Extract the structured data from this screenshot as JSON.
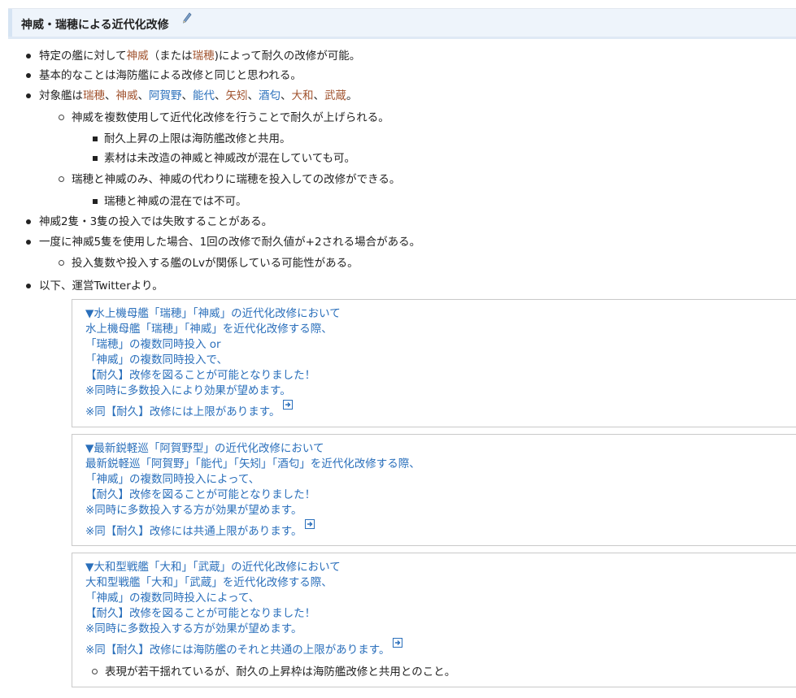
{
  "heading": {
    "title": "神威・瑞穂による近代化改修"
  },
  "bullets": {
    "b1": {
      "pre": "特定の艦に対して",
      "link1": "神威",
      "mid1": "（または",
      "link2": "瑞穂",
      "post": ")によって耐久の改修が可能。"
    },
    "b2": {
      "text": "基本的なことは海防艦による改修と同じと思われる。"
    },
    "b3": {
      "pre": "対象艦は",
      "ships": [
        {
          "name": "瑞穂",
          "color": "#a0522d",
          "sep": "、"
        },
        {
          "name": "神威",
          "color": "#a0522d",
          "sep": "、"
        },
        {
          "name": "阿賀野",
          "color": "#2a6fbb",
          "sep": "、"
        },
        {
          "name": "能代",
          "color": "#2a6fbb",
          "sep": "、"
        },
        {
          "name": "矢矧",
          "color": "#a0522d",
          "sep": "、"
        },
        {
          "name": "酒匂",
          "color": "#2a6fbb",
          "sep": "、"
        },
        {
          "name": "大和",
          "color": "#a0522d",
          "sep": "、"
        },
        {
          "name": "武蔵",
          "color": "#a0522d",
          "sep": "。"
        }
      ],
      "sub1": "神威を複数使用して近代化改修を行うことで耐久が上げられる。",
      "sub1a": "耐久上昇の上限は海防艦改修と共用。",
      "sub1b": "素材は未改造の神威と神威改が混在していても可。",
      "sub2": "瑞穂と神威のみ、神威の代わりに瑞穂を投入しての改修ができる。",
      "sub2a": "瑞穂と神威の混在では不可。"
    },
    "b4": {
      "text": "神威2隻・3隻の投入では失敗することがある。"
    },
    "b5": {
      "text": "一度に神威5隻を使用した場合、1回の改修で耐久値が+2される場合がある。",
      "sub": "投入隻数や投入する艦のLvが関係している可能性がある。"
    },
    "b6": {
      "text": "以下、運営Twitterより。"
    }
  },
  "tweets": [
    {
      "lines": [
        "▼水上機母艦「瑞穂」「神威」の近代化改修において",
        "水上機母艦「瑞穂」「神威」を近代化改修する際、",
        "「瑞穂」の複数同時投入 or",
        "「神威」の複数同時投入で、",
        "【耐久】改修を図ることが可能となりました！",
        "※同時に多数投入により効果が望めます。"
      ],
      "last": "※同【耐久】改修には上限があります。"
    },
    {
      "lines": [
        "▼最新鋭軽巡「阿賀野型」の近代化改修において",
        "最新鋭軽巡「阿賀野」「能代」「矢矧」「酒匂」を近代化改修する際、",
        "「神威」の複数同時投入によって、",
        "【耐久】改修を図ることが可能となりました！",
        "※同時に多数投入する方が効果が望めます。"
      ],
      "last": "※同【耐久】改修には共通上限があります。"
    },
    {
      "lines": [
        "▼大和型戦艦「大和」「武蔵」の近代化改修において",
        "大和型戦艦「大和」「武蔵」を近代化改修する際、",
        "「神威」の複数同時投入によって、",
        "【耐久】改修を図ることが可能となりました！",
        "※同時に多数投入する方が効果が望めます。"
      ],
      "last": "※同【耐久】改修には海防艦のそれと共通の上限があります。",
      "note": "表現が若干揺れているが、耐久の上昇枠は海防艦改修と共用とのこと。"
    }
  ],
  "icons": {
    "edit": "pencil-icon",
    "external": "external-link-icon"
  },
  "colors": {
    "link_visited": "#a0522d",
    "link": "#2a6fbb",
    "heading_bg": "#eef4fb"
  }
}
